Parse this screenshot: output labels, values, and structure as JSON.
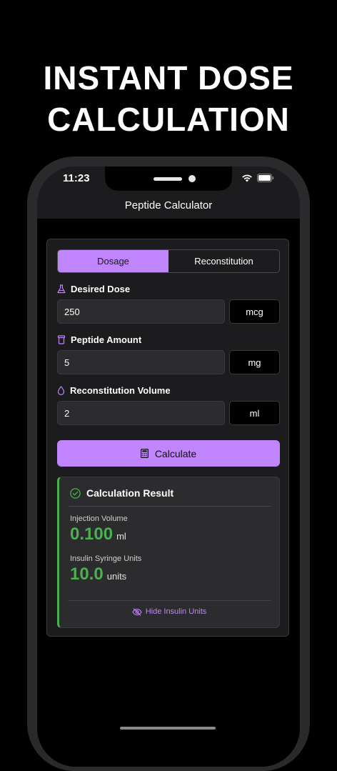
{
  "headline": {
    "line1": "INSTANT DOSE",
    "line2": "CALCULATION"
  },
  "status": {
    "time": "11:23"
  },
  "nav": {
    "title": "Peptide Calculator"
  },
  "tabs": {
    "dosage": "Dosage",
    "reconstitution": "Reconstitution"
  },
  "fields": [
    {
      "label": "Desired Dose",
      "value": "250",
      "unit": "mcg",
      "icon": "flask-icon"
    },
    {
      "label": "Peptide Amount",
      "value": "5",
      "unit": "mg",
      "icon": "vial-icon"
    },
    {
      "label": "Reconstitution Volume",
      "value": "2",
      "unit": "ml",
      "icon": "droplet-icon"
    }
  ],
  "calculate": {
    "label": "Calculate",
    "icon": "calculator-icon"
  },
  "result": {
    "title": "Calculation Result",
    "injection_label": "Injection Volume",
    "injection_value": "0.100",
    "injection_unit": "ml",
    "syringe_label": "Insulin Syringe Units",
    "syringe_value": "10.0",
    "syringe_unit": "units",
    "hide_label": "Hide Insulin Units"
  },
  "colors": {
    "accent": "#c084fc",
    "success": "#4caf50",
    "background": "#000000",
    "surface": "#1c1c1e"
  }
}
